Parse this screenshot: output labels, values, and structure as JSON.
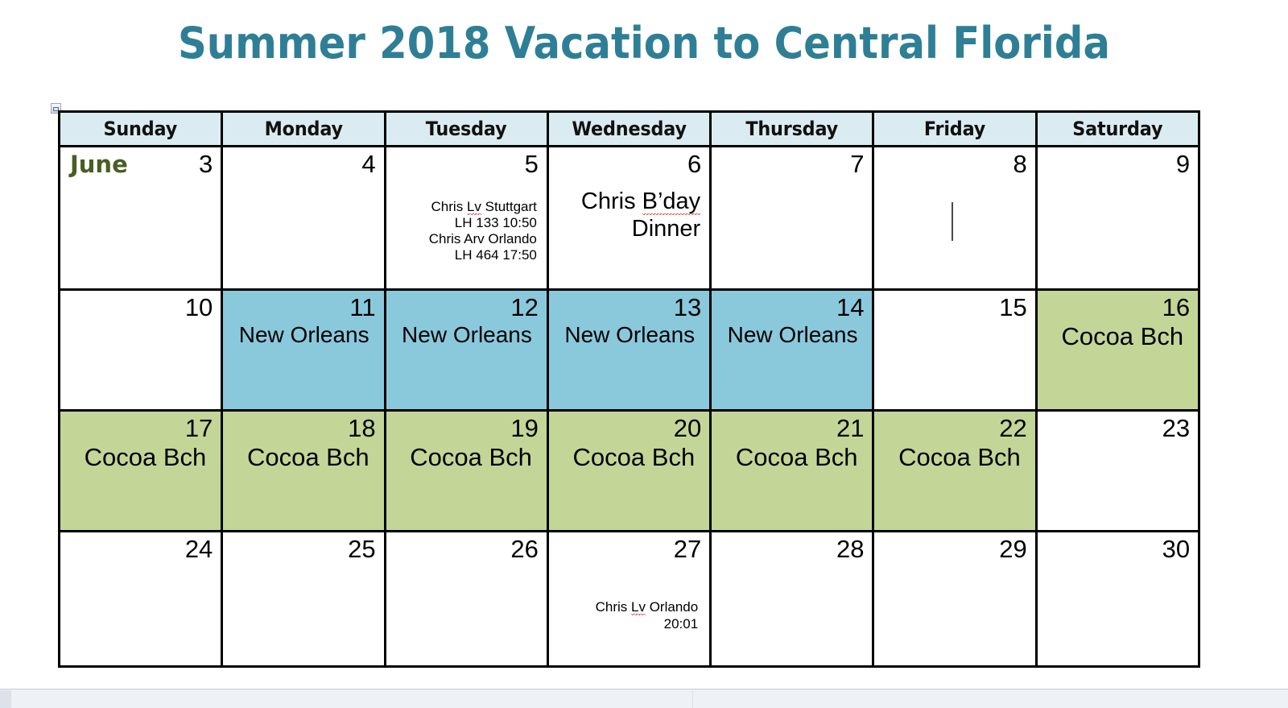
{
  "page": {
    "title": "Summer 2018 Vacation to Central Florida",
    "title_color": "#2E7F96"
  },
  "colors": {
    "header_fill": "#DBEBF2",
    "blue_fill": "#8AC9DC",
    "green_fill": "#C3D697",
    "month_label": "#4A5D23",
    "border": "#000000"
  },
  "calendar": {
    "month_label": "June",
    "weekday_headers": [
      "Sunday",
      "Monday",
      "Tuesday",
      "Wednesday",
      "Thursday",
      "Friday",
      "Saturday"
    ],
    "weeks": [
      {
        "days": [
          {
            "num": "3",
            "fill": "white",
            "month": "June",
            "event": ""
          },
          {
            "num": "4",
            "fill": "white",
            "event": ""
          },
          {
            "num": "5",
            "fill": "white",
            "event_line1": "Chris ",
            "event_misspelled": "Lv",
            "event_rest": " Stuttgart\nLH 133  10:50\nChris Arv Orlando\nLH 464  17:50"
          },
          {
            "num": "6",
            "fill": "white",
            "event_line1": "Chris ",
            "event_misspelled": "B’day",
            "event_rest": "\nDinner"
          },
          {
            "num": "7",
            "fill": "white",
            "event": ""
          },
          {
            "num": "8",
            "fill": "white",
            "event": ""
          },
          {
            "num": "9",
            "fill": "white",
            "event": ""
          }
        ]
      },
      {
        "days": [
          {
            "num": "10",
            "fill": "white",
            "event": ""
          },
          {
            "num": "11",
            "fill": "blue",
            "event": "New Orleans"
          },
          {
            "num": "12",
            "fill": "blue",
            "event": "New Orleans"
          },
          {
            "num": "13",
            "fill": "blue",
            "event": "New Orleans"
          },
          {
            "num": "14",
            "fill": "blue",
            "event": "New Orleans"
          },
          {
            "num": "15",
            "fill": "white",
            "event": ""
          },
          {
            "num": "16",
            "fill": "green",
            "event": "Cocoa Bch"
          }
        ]
      },
      {
        "days": [
          {
            "num": "17",
            "fill": "green",
            "event": "Cocoa Bch"
          },
          {
            "num": "18",
            "fill": "green",
            "event": "Cocoa Bch"
          },
          {
            "num": "19",
            "fill": "green",
            "event": "Cocoa Bch"
          },
          {
            "num": "20",
            "fill": "green",
            "event": "Cocoa Bch"
          },
          {
            "num": "21",
            "fill": "green",
            "event": "Cocoa Bch"
          },
          {
            "num": "22",
            "fill": "green",
            "event": "Cocoa Bch"
          },
          {
            "num": "23",
            "fill": "white",
            "event": ""
          }
        ]
      },
      {
        "days": [
          {
            "num": "24",
            "fill": "white",
            "event": ""
          },
          {
            "num": "25",
            "fill": "white",
            "event": ""
          },
          {
            "num": "26",
            "fill": "white",
            "event": ""
          },
          {
            "num": "27",
            "fill": "white",
            "event_line1": "Chris ",
            "event_misspelled": "Lv",
            "event_rest": " Orlando\n20:01"
          },
          {
            "num": "28",
            "fill": "white",
            "event": ""
          },
          {
            "num": "29",
            "fill": "white",
            "event": ""
          },
          {
            "num": "30",
            "fill": "white",
            "event": ""
          }
        ]
      }
    ]
  }
}
